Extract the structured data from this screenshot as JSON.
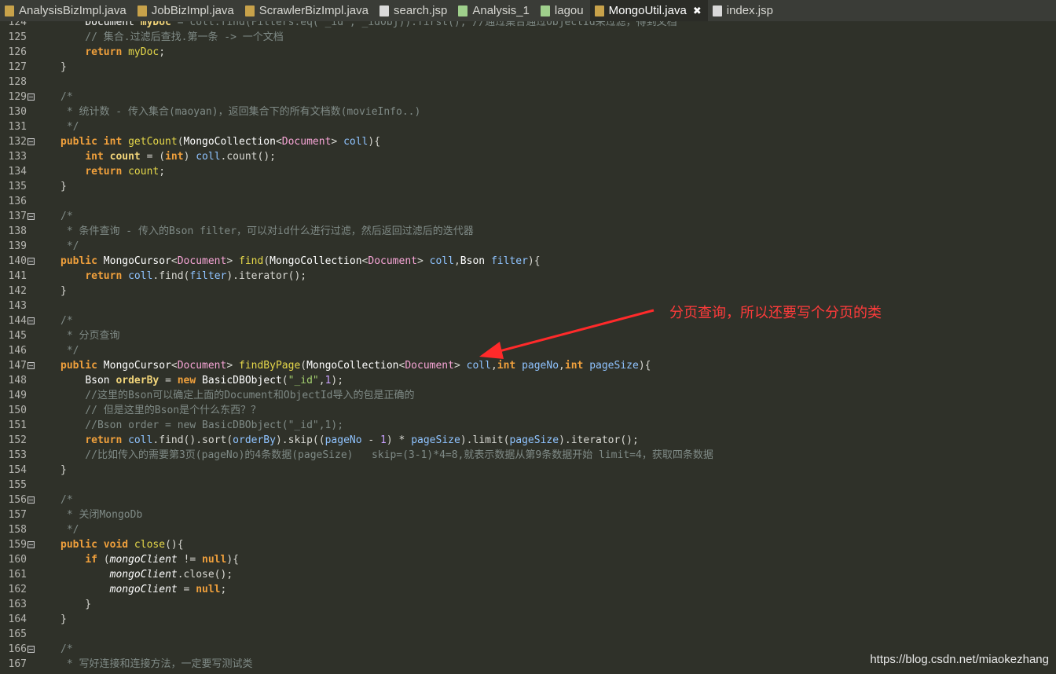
{
  "tabs": [
    {
      "label": "AnalysisBizImpl.java",
      "icon": "java-file-icon"
    },
    {
      "label": "JobBizImpl.java",
      "icon": "java-file-icon"
    },
    {
      "label": "ScrawlerBizImpl.java",
      "icon": "java-file-icon"
    },
    {
      "label": "search.jsp",
      "icon": "jsp-file-icon"
    },
    {
      "label": "Analysis_1",
      "icon": "run-config-icon"
    },
    {
      "label": "lagou",
      "icon": "run-config-icon"
    },
    {
      "label": "MongoUtil.java",
      "icon": "java-file-icon",
      "active": true,
      "close": "✖"
    },
    {
      "label": "index.jsp",
      "icon": "jsp-file-icon"
    }
  ],
  "annotation": "分页查询，所以还要写个分页的类",
  "watermark": "https://blog.csdn.net/miaokezhang",
  "colors": {
    "annotation": "#ff3b3b",
    "editor_bg": "#2f3129"
  },
  "lines": [
    {
      "n": "124",
      "fold": false,
      "seg": [
        [
          "    ",
          ""
        ],
        [
          "Document ",
          "ty"
        ],
        [
          "myDoc",
          "pv"
        ],
        [
          " = coll.find(Filters.eq(\"_id\", _idObj)).first(); //通过集合通过ObjectId来过滤，得到文档",
          "cm"
        ]
      ]
    },
    {
      "n": "125",
      "fold": false,
      "seg": [
        [
          "    // 集合.过滤后查找.第一条 -> 一个文档",
          "cm"
        ]
      ]
    },
    {
      "n": "126",
      "fold": false,
      "seg": [
        [
          "    ",
          ""
        ],
        [
          "return ",
          "kw"
        ],
        [
          "myDoc",
          "nm"
        ],
        [
          ";",
          ""
        ]
      ]
    },
    {
      "n": "127",
      "fold": false,
      "seg": [
        [
          "}",
          ""
        ]
      ]
    },
    {
      "n": "128",
      "fold": false,
      "seg": []
    },
    {
      "n": "129",
      "fold": true,
      "seg": [
        [
          "/*",
          "cm"
        ]
      ]
    },
    {
      "n": "130",
      "fold": false,
      "seg": [
        [
          " * 统计数 - 传入集合(maoyan)，返回集合下的所有文档数(movieInfo..)",
          "cm"
        ]
      ]
    },
    {
      "n": "131",
      "fold": false,
      "seg": [
        [
          " */",
          "cm"
        ]
      ]
    },
    {
      "n": "132",
      "fold": true,
      "seg": [
        [
          "public int ",
          "kw"
        ],
        [
          "getCount",
          "nm"
        ],
        [
          "(",
          ""
        ],
        [
          "MongoCollection",
          "ty"
        ],
        [
          "<",
          ""
        ],
        [
          "Document",
          "gen"
        ],
        [
          "> ",
          ""
        ],
        [
          "coll",
          "pa"
        ],
        [
          "){",
          ""
        ]
      ]
    },
    {
      "n": "133",
      "fold": false,
      "seg": [
        [
          "    ",
          ""
        ],
        [
          "int ",
          "kw"
        ],
        [
          "count",
          "pv"
        ],
        [
          " = (",
          ""
        ],
        [
          "int",
          "kw"
        ],
        [
          ") ",
          ""
        ],
        [
          "coll",
          "pa"
        ],
        [
          ".count();",
          ""
        ]
      ]
    },
    {
      "n": "134",
      "fold": false,
      "seg": [
        [
          "    ",
          ""
        ],
        [
          "return ",
          "kw"
        ],
        [
          "count",
          "nm"
        ],
        [
          ";",
          ""
        ]
      ]
    },
    {
      "n": "135",
      "fold": false,
      "seg": [
        [
          "}",
          ""
        ]
      ]
    },
    {
      "n": "136",
      "fold": false,
      "seg": []
    },
    {
      "n": "137",
      "fold": true,
      "seg": [
        [
          "/*",
          "cm"
        ]
      ]
    },
    {
      "n": "138",
      "fold": false,
      "seg": [
        [
          " * 条件查询 - 传入的Bson filter，可以对id什么进行过滤，然后返回过滤后的迭代器",
          "cm"
        ]
      ]
    },
    {
      "n": "139",
      "fold": false,
      "seg": [
        [
          " */",
          "cm"
        ]
      ]
    },
    {
      "n": "140",
      "fold": true,
      "seg": [
        [
          "public ",
          "kw"
        ],
        [
          "MongoCursor",
          "ty"
        ],
        [
          "<",
          ""
        ],
        [
          "Document",
          "gen"
        ],
        [
          "> ",
          ""
        ],
        [
          "find",
          "nm"
        ],
        [
          "(",
          ""
        ],
        [
          "MongoCollection",
          "ty"
        ],
        [
          "<",
          ""
        ],
        [
          "Document",
          "gen"
        ],
        [
          "> ",
          ""
        ],
        [
          "coll",
          "pa"
        ],
        [
          ",",
          ""
        ],
        [
          "Bson ",
          "ty"
        ],
        [
          "filter",
          "pa"
        ],
        [
          "){",
          ""
        ]
      ]
    },
    {
      "n": "141",
      "fold": false,
      "seg": [
        [
          "    ",
          ""
        ],
        [
          "return ",
          "kw"
        ],
        [
          "coll",
          "pa"
        ],
        [
          ".find(",
          ""
        ],
        [
          "filter",
          "pa"
        ],
        [
          ").iterator();",
          ""
        ]
      ]
    },
    {
      "n": "142",
      "fold": false,
      "seg": [
        [
          "}",
          ""
        ]
      ]
    },
    {
      "n": "143",
      "fold": false,
      "seg": []
    },
    {
      "n": "144",
      "fold": true,
      "seg": [
        [
          "/*",
          "cm"
        ]
      ]
    },
    {
      "n": "145",
      "fold": false,
      "seg": [
        [
          " * 分页查询",
          "cm"
        ]
      ]
    },
    {
      "n": "146",
      "fold": false,
      "seg": [
        [
          " */",
          "cm"
        ]
      ]
    },
    {
      "n": "147",
      "fold": true,
      "seg": [
        [
          "public ",
          "kw"
        ],
        [
          "MongoCursor",
          "ty"
        ],
        [
          "<",
          ""
        ],
        [
          "Document",
          "gen"
        ],
        [
          "> ",
          ""
        ],
        [
          "findByPage",
          "nm"
        ],
        [
          "(",
          ""
        ],
        [
          "MongoCollection",
          "ty"
        ],
        [
          "<",
          ""
        ],
        [
          "Document",
          "gen"
        ],
        [
          "> ",
          ""
        ],
        [
          "coll",
          "pa"
        ],
        [
          ",",
          ""
        ],
        [
          "int ",
          "kw"
        ],
        [
          "pageNo",
          "pa"
        ],
        [
          ",",
          ""
        ],
        [
          "int ",
          "kw"
        ],
        [
          "pageSize",
          "pa"
        ],
        [
          "){",
          ""
        ]
      ]
    },
    {
      "n": "148",
      "fold": false,
      "seg": [
        [
          "    ",
          ""
        ],
        [
          "Bson ",
          "ty"
        ],
        [
          "orderBy",
          "pv"
        ],
        [
          " = ",
          ""
        ],
        [
          "new ",
          "kw"
        ],
        [
          "BasicDBObject",
          "ty"
        ],
        [
          "(",
          ""
        ],
        [
          "\"_id\"",
          "st"
        ],
        [
          ",",
          ""
        ],
        [
          "1",
          "num"
        ],
        [
          ");",
          ""
        ]
      ]
    },
    {
      "n": "149",
      "fold": false,
      "seg": [
        [
          "    //这里的Bson可以确定上面的Document和ObjectId导入的包是正确的",
          "cm"
        ]
      ]
    },
    {
      "n": "150",
      "fold": false,
      "seg": [
        [
          "    // 但是这里的Bson是个什么东西？？",
          "cm"
        ]
      ]
    },
    {
      "n": "151",
      "fold": false,
      "seg": [
        [
          "    //Bson order = new BasicDBObject(\"_id\",1);",
          "cm"
        ]
      ]
    },
    {
      "n": "152",
      "fold": false,
      "seg": [
        [
          "    ",
          ""
        ],
        [
          "return ",
          "kw"
        ],
        [
          "coll",
          "pa"
        ],
        [
          ".find().sort(",
          ""
        ],
        [
          "orderBy",
          "pa"
        ],
        [
          ").skip((",
          ""
        ],
        [
          "pageNo",
          "pa"
        ],
        [
          " - ",
          ""
        ],
        [
          "1",
          "num"
        ],
        [
          ") * ",
          ""
        ],
        [
          "pageSize",
          "pa"
        ],
        [
          ").limit(",
          ""
        ],
        [
          "pageSize",
          "pa"
        ],
        [
          ").iterator();",
          ""
        ]
      ]
    },
    {
      "n": "153",
      "fold": false,
      "seg": [
        [
          "    //比如传入的需要第3页(pageNo)的4条数据(pageSize)   skip=(3-1)*4=8,就表示数据从第9条数据开始 limit=4，获取四条数据",
          "cm"
        ]
      ]
    },
    {
      "n": "154",
      "fold": false,
      "seg": [
        [
          "}",
          ""
        ]
      ]
    },
    {
      "n": "155",
      "fold": false,
      "seg": []
    },
    {
      "n": "156",
      "fold": true,
      "seg": [
        [
          "/*",
          "cm"
        ]
      ]
    },
    {
      "n": "157",
      "fold": false,
      "seg": [
        [
          " * 关闭MongoDb",
          "cm"
        ]
      ]
    },
    {
      "n": "158",
      "fold": false,
      "seg": [
        [
          " */",
          "cm"
        ]
      ]
    },
    {
      "n": "159",
      "fold": true,
      "seg": [
        [
          "public void ",
          "kw"
        ],
        [
          "close",
          "nm"
        ],
        [
          "(){",
          ""
        ]
      ]
    },
    {
      "n": "160",
      "fold": false,
      "seg": [
        [
          "    ",
          ""
        ],
        [
          "if ",
          "kw"
        ],
        [
          "(",
          ""
        ],
        [
          "mongoClient",
          "it"
        ],
        [
          " != ",
          ""
        ],
        [
          "null",
          "kw"
        ],
        [
          "){",
          ""
        ]
      ]
    },
    {
      "n": "161",
      "fold": false,
      "seg": [
        [
          "        ",
          ""
        ],
        [
          "mongoClient",
          "it"
        ],
        [
          ".close();",
          ""
        ]
      ]
    },
    {
      "n": "162",
      "fold": false,
      "seg": [
        [
          "        ",
          ""
        ],
        [
          "mongoClient",
          "it"
        ],
        [
          " = ",
          ""
        ],
        [
          "null",
          "kw"
        ],
        [
          ";",
          ""
        ]
      ]
    },
    {
      "n": "163",
      "fold": false,
      "seg": [
        [
          "    }",
          ""
        ]
      ]
    },
    {
      "n": "164",
      "fold": false,
      "seg": [
        [
          "}",
          ""
        ]
      ]
    },
    {
      "n": "165",
      "fold": false,
      "seg": []
    },
    {
      "n": "166",
      "fold": true,
      "seg": [
        [
          "/*",
          "cm"
        ]
      ]
    },
    {
      "n": "167",
      "fold": false,
      "seg": [
        [
          " * 写好连接和连接方法，一定要写测试类",
          "cm"
        ]
      ]
    }
  ]
}
